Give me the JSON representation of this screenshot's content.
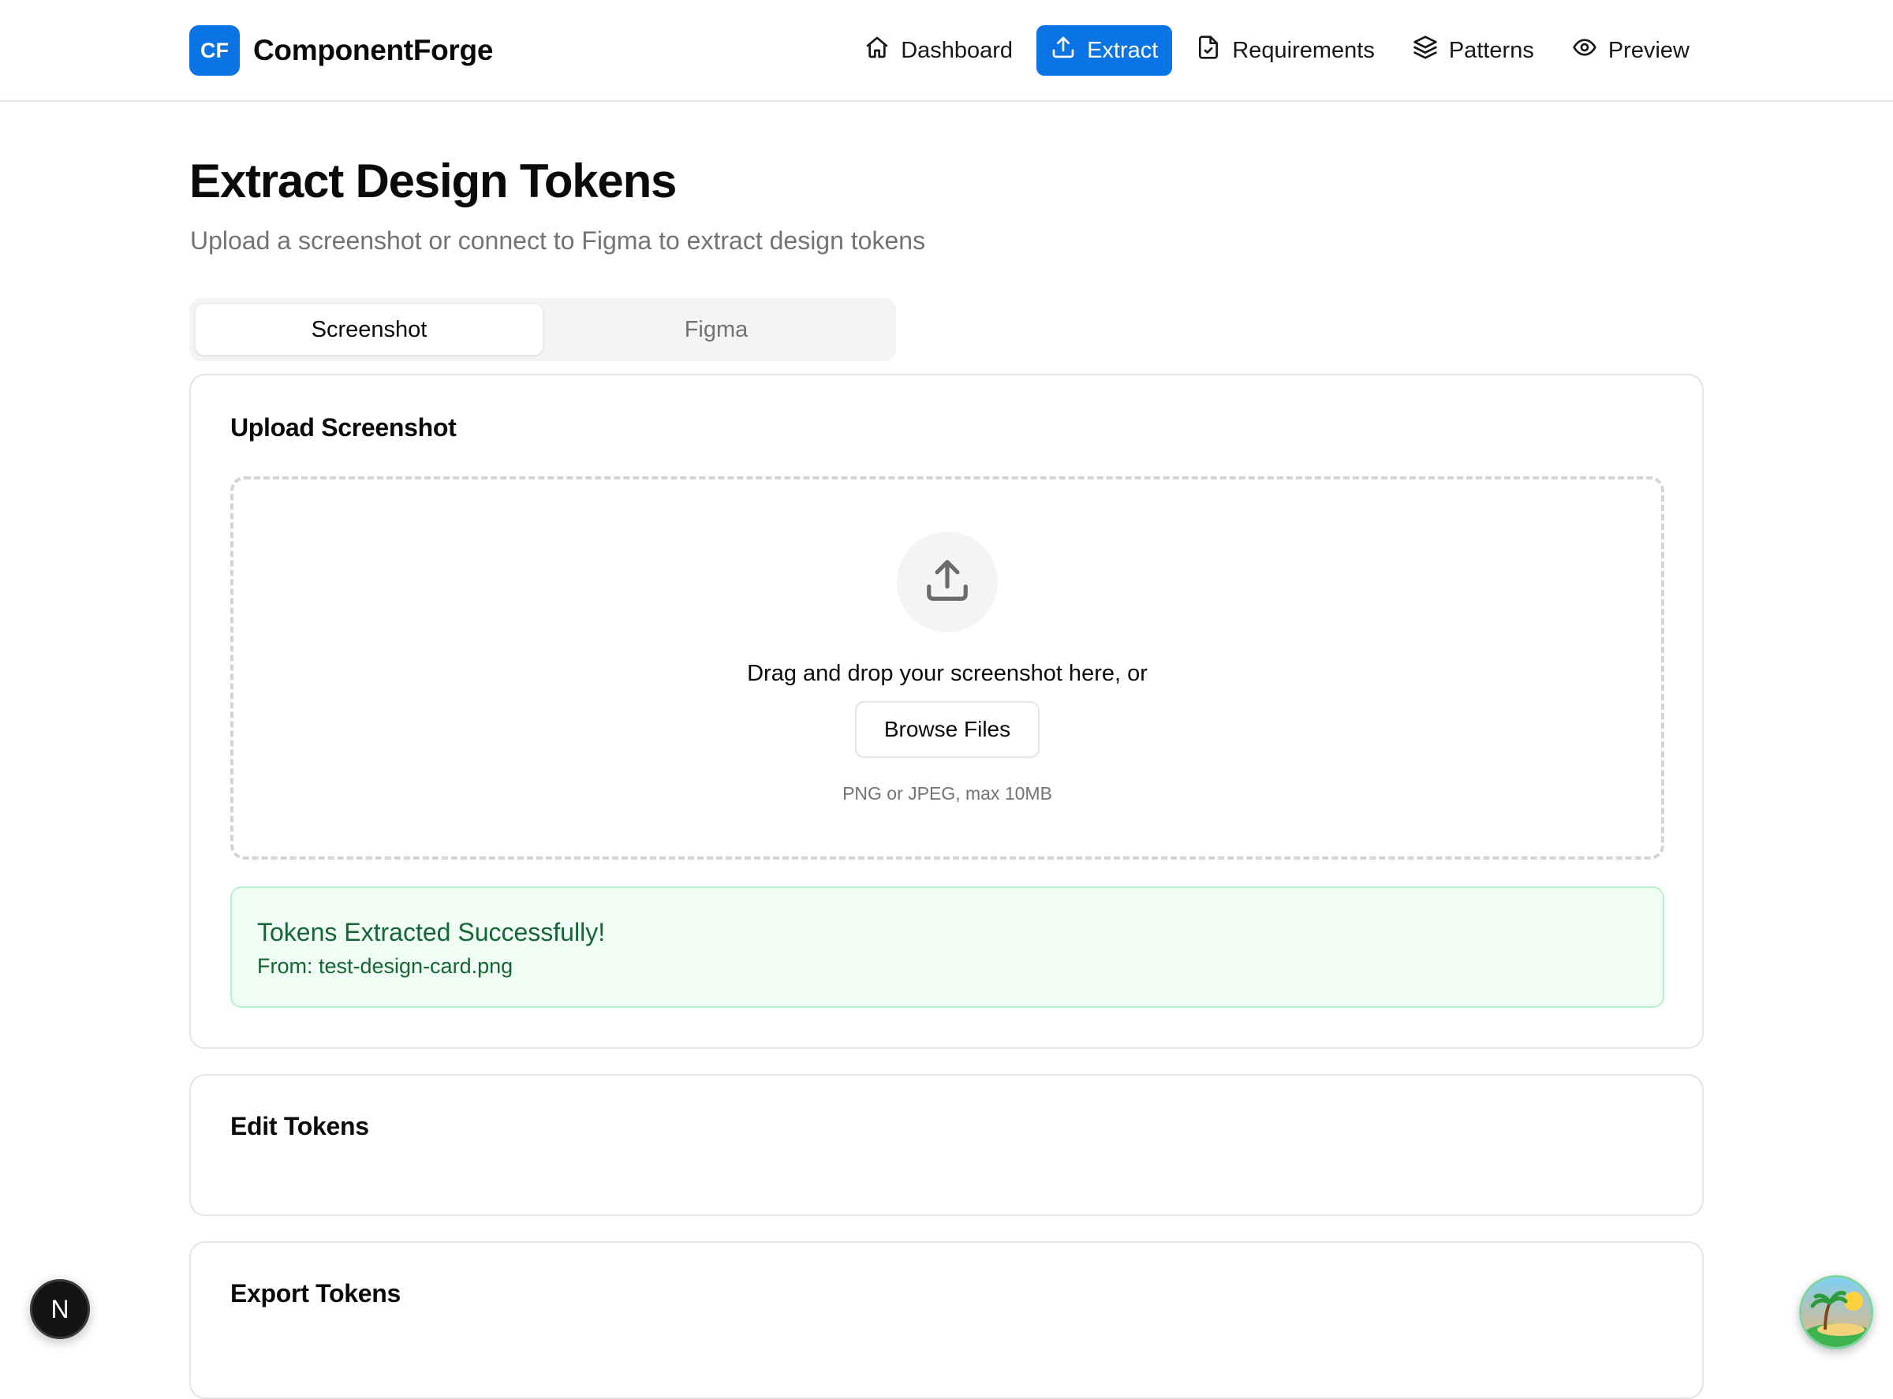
{
  "brand": {
    "logo": "CF",
    "name": "ComponentForge",
    "color": "#0b74e5"
  },
  "nav": [
    {
      "label": "Dashboard",
      "icon": "home-icon",
      "active": false
    },
    {
      "label": "Extract",
      "icon": "upload-icon",
      "active": true
    },
    {
      "label": "Requirements",
      "icon": "file-check-icon",
      "active": false
    },
    {
      "label": "Patterns",
      "icon": "layers-icon",
      "active": false
    },
    {
      "label": "Preview",
      "icon": "eye-icon",
      "active": false
    }
  ],
  "page": {
    "title": "Extract Design Tokens",
    "subtitle": "Upload a screenshot or connect to Figma to extract design tokens"
  },
  "tabs": [
    {
      "label": "Screenshot",
      "active": true
    },
    {
      "label": "Figma",
      "active": false
    }
  ],
  "upload": {
    "title": "Upload Screenshot",
    "drop_text": "Drag and drop your screenshot here, or",
    "browse_label": "Browse Files",
    "hint": "PNG or JPEG, max 10MB"
  },
  "success": {
    "title": "Tokens Extracted Successfully!",
    "from": "From: test-design-card.png",
    "color": "#166534"
  },
  "edit": {
    "title": "Edit Tokens"
  },
  "export": {
    "title": "Export Tokens"
  },
  "floating": {
    "next_badge": "N"
  }
}
